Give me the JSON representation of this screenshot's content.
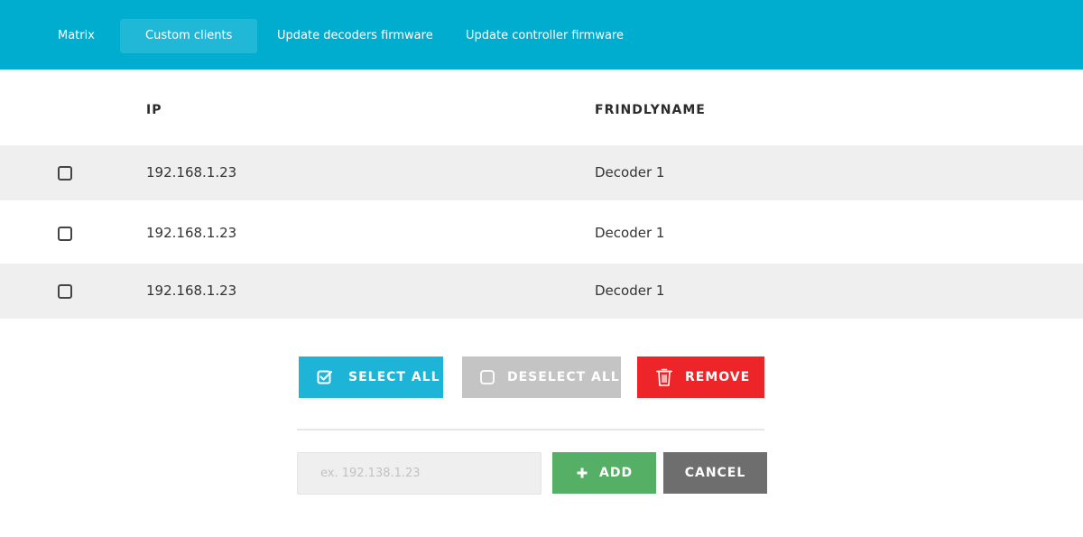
{
  "nav": {
    "items": [
      {
        "label": "Matrix"
      },
      {
        "label": "Custom clients"
      },
      {
        "label": "Update decoders firmware"
      },
      {
        "label": "Update controller firmware"
      }
    ],
    "active": "Custom clients"
  },
  "table": {
    "columns": [
      "IP",
      "FRINDLYNAME"
    ],
    "rows": [
      {
        "ip": "192.168.1.23",
        "name": "Decoder 1",
        "checked": false
      },
      {
        "ip": "192.168.1.23",
        "name": "Decoder 1",
        "checked": false
      },
      {
        "ip": "192.168.1.23",
        "name": "Decoder 1",
        "checked": false
      }
    ]
  },
  "actions": {
    "select_all": "SELECT ALL",
    "deselect_all": "DESELECT ALL",
    "remove": "REMOVE"
  },
  "add_form": {
    "input_value": "",
    "input_placeholder": "ex. 192.138.1.23",
    "add_label": "ADD",
    "cancel_label": "CANCEL"
  },
  "colors": {
    "header_bar": "#00adcf",
    "select_all": "#1eb4d7",
    "deselect_all": "#c4c4c4",
    "remove": "#ee2528",
    "add": "#55af65",
    "cancel": "#6e6e6e"
  }
}
